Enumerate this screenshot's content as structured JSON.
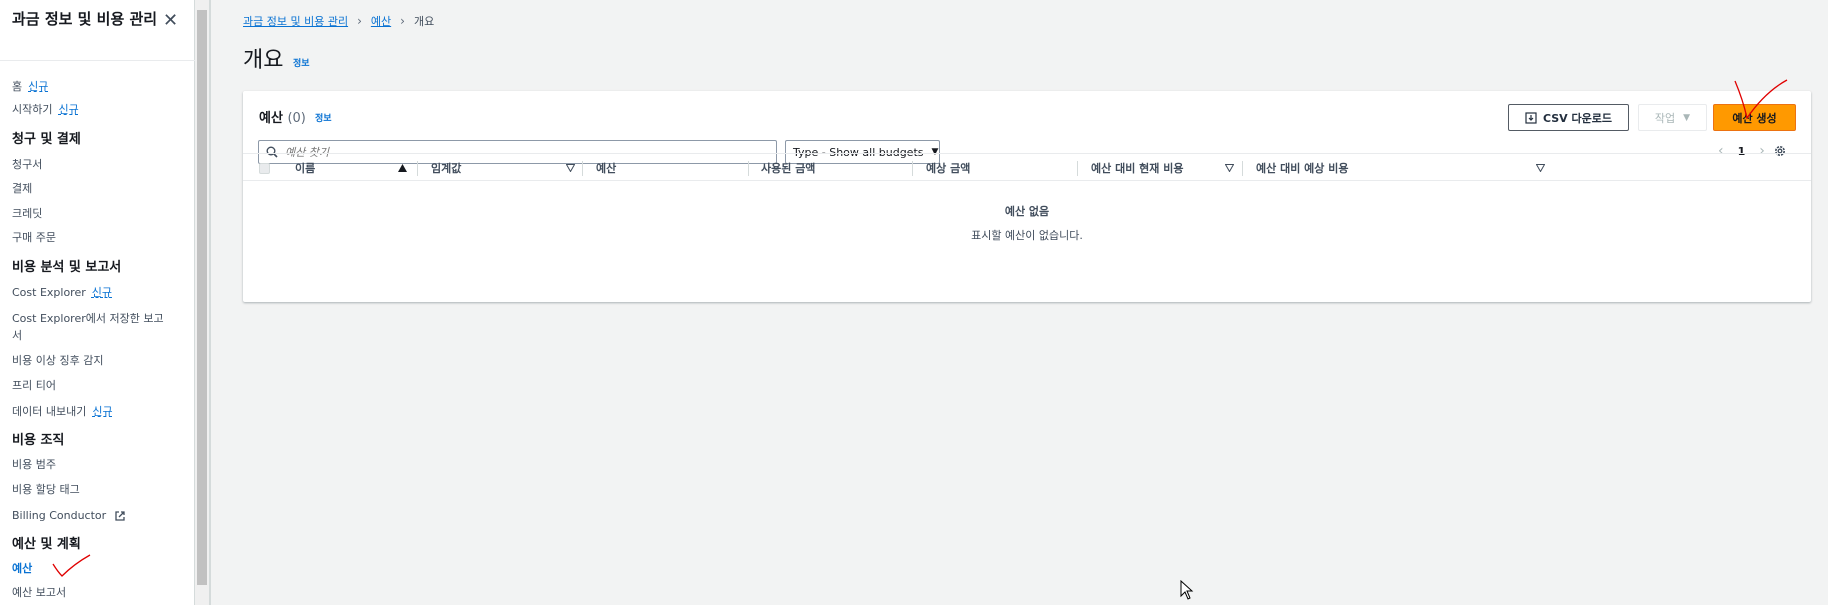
{
  "sidebar": {
    "title": "과금 정보 및 비용 관리",
    "items": {
      "home": {
        "label": "홈",
        "badge": "신규"
      },
      "getting_started": {
        "label": "시작하기",
        "badge": "신규"
      },
      "section_billing": "청구 및 결제",
      "bills": "청구서",
      "payments": "결제",
      "credits": "크레딧",
      "purchase_orders": "구매 주문",
      "section_cost_analysis": "비용 분석 및 보고서",
      "cost_explorer": {
        "label": "Cost Explorer",
        "badge": "신규"
      },
      "saved_reports": "Cost Explorer에서 저장한 보고서",
      "anomaly": "비용 이상 징후 감지",
      "free_tier": "프리 티어",
      "data_exports": {
        "label": "데이터 내보내기",
        "badge": "신규"
      },
      "section_cost_org": "비용 조직",
      "cost_categories": "비용 범주",
      "cost_allocation_tags": "비용 할당 태그",
      "billing_conductor": "Billing Conductor",
      "section_budgets": "예산 및 계획",
      "budgets": "예산",
      "budget_reports": "예산 보고서"
    }
  },
  "breadcrumb": {
    "root": "과금 정보 및 비용 관리",
    "budgets": "예산",
    "current": "개요"
  },
  "page": {
    "title": "개요",
    "info": "정보"
  },
  "card": {
    "title": "예산",
    "count": "(0)",
    "info": "정보",
    "csv_button": "CSV 다운로드",
    "actions_button": "작업",
    "create_button": "예산 생성",
    "search_placeholder": "예산 찾기",
    "type_filter": "Type - Show all budgets",
    "page_number": "1"
  },
  "table": {
    "columns": [
      "이름",
      "임계값",
      "예산",
      "사용된 금액",
      "예상 금액",
      "예산 대비 현재 비용",
      "예산 대비 예상 비용"
    ],
    "empty_title": "예산 없음",
    "empty_description": "표시할 예산이 없습니다."
  },
  "colors": {
    "primary": "#ff9900",
    "link": "#0972d3",
    "annotation": "#e00000"
  }
}
